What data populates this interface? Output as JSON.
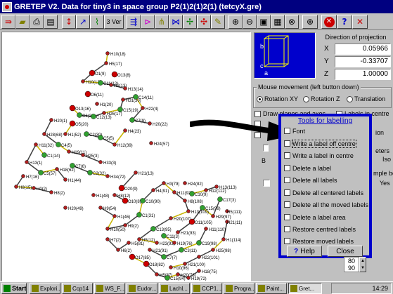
{
  "window": {
    "title": "GRETEP V2. Data for    tiny3 in space group P2(1)2(1)2(1) (tetcyX.gre)"
  },
  "toolbar": {
    "view3d_label": "3 Ver",
    "zoom_in_icon": "magnifier-plus-icon",
    "zoom_out_icon": "magnifier-minus-icon",
    "stop_icon": "stop-icon",
    "help_icon": "question-icon",
    "close_icon": "close-x-icon"
  },
  "projection": {
    "title": "Direction of projection",
    "x_label": "X",
    "x_value": "0.05966",
    "y_label": "Y",
    "y_value": "-0.33707",
    "z_label": "Z",
    "z_value": "1.00000",
    "axis_labels": [
      "b",
      "c",
      "a"
    ]
  },
  "mouse": {
    "title": "Mouse movement (left button down)",
    "options": [
      {
        "label": "Rotation XY",
        "selected": true
      },
      {
        "label": "Rotation Z",
        "selected": false
      },
      {
        "label": "Translation",
        "selected": false
      }
    ]
  },
  "background_panel": {
    "draw_planes": "Draw planes and axes",
    "labels_centre": "Labels in centre",
    "ion_suffix": "ion",
    "eters_suffix": "eters",
    "iso_label": "Iso",
    "b_label": "B",
    "mple_label": "mple bo",
    "yes_label": "Yes",
    "spin_values": [
      "80",
      "90"
    ]
  },
  "tools": {
    "title": "Tools for labelling",
    "items": [
      "Font",
      "Write a label off centre",
      "Write a label in centre",
      "Delete a label",
      "Delete all labels",
      "Delete all centered labels",
      "Delete all the moved labels",
      "Delete a label area",
      "Restore centred labels",
      "Restore moved labels"
    ],
    "help_label": "Help",
    "close_label": "Close"
  },
  "molecule": {
    "atom_labels": [
      "H10(18)",
      "H5(17)",
      "O1(9)",
      "H10(12)",
      "C11(12)",
      "H2(13)",
      "H13(14)",
      "O6(11)",
      "O13(8)",
      "H1(20)",
      "O13(16)",
      "C6(21)",
      "C12(13)",
      "H26(17)",
      "C15(19)",
      "H31(30)",
      "C14(11)",
      "H22(4)",
      "C7(9)",
      "H20(22)",
      "H1(52)",
      "O5(20)",
      "H24(57)",
      "C2(30)",
      "C5(5)",
      "H12(39)",
      "H4(23)",
      "H20(1)",
      "H28(68)",
      "C4(5)",
      "H19(11)",
      "H25(3)",
      "H33(3)",
      "C1(14)",
      "H11(32)",
      "H13(1)",
      "C5(57)",
      "H18(62)",
      "H1(44)",
      "H7(16)",
      "H8(15)",
      "H0(2)",
      "H8(2)",
      "C7(6)",
      "C2(32)",
      "H34(72)",
      "H21(13)",
      "O20(9)",
      "H1(48)",
      "H20(49)",
      "H9(54)",
      "H1(46)",
      "H10(50)",
      "H9(2)",
      "C1(31)",
      "C10(90)",
      "H4(91)",
      "H3(79)",
      "H11(92)",
      "H8(108)",
      "H13(109)",
      "H20(107)",
      "C13(95)",
      "H5(12)",
      "H23(93)",
      "H21(93)",
      "O11(105)",
      "C15(99)",
      "H29(97)",
      "C17(3)",
      "H11(110)",
      "C19(98)",
      "C3(11)",
      "C7(7)",
      "H21(91)",
      "H10(96)",
      "H21(100)",
      "H22(101)",
      "H25(98)",
      "H1(114)",
      "H21(11)",
      "H13(113)",
      "H12(112)",
      "C10(9)",
      "H5(81)",
      "H6(2)",
      "H7(2)",
      "O17(85)",
      "O18(82)",
      "H5(87)",
      "C15(94)",
      "H20(73)",
      "H19(72)",
      "H18(75)",
      "H19(76)",
      "C11(3)",
      "H24(82)",
      "H5(111)",
      "O10(8)",
      "H8(12)"
    ]
  }
}
